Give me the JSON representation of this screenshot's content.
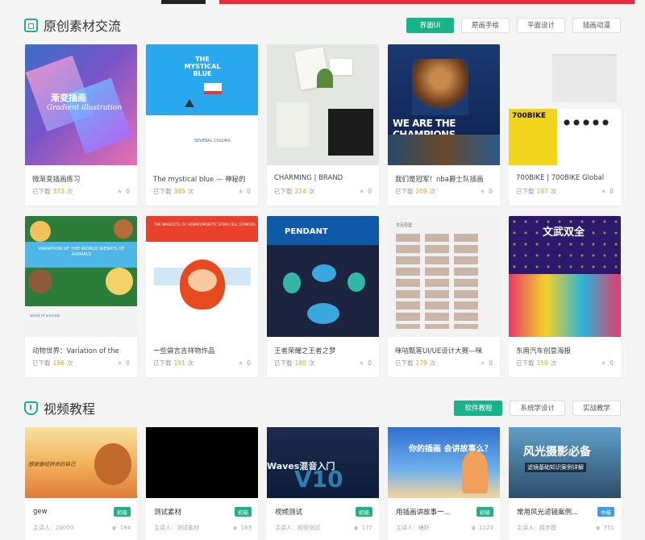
{
  "section1": {
    "title": "原创素材交流",
    "tabs": [
      "界面UI",
      "原画手绘",
      "平面设计",
      "插画动漫"
    ]
  },
  "cards": [
    {
      "title": "微渐变插画练习",
      "downloaded": "已下载",
      "count": "373",
      "unit": "次",
      "likes": "0",
      "thumb_text1": "渐变插画",
      "thumb_text2": "Gradient illustration"
    },
    {
      "title": "The mystical blue — 神秘的",
      "downloaded": "已下载",
      "count": "345",
      "unit": "次",
      "likes": "0",
      "thumb_text1": "THE MYSTICAL BLUE",
      "thumb_text2": "SEVERAL COLORS"
    },
    {
      "title": "CHARMING | BRAND",
      "downloaded": "已下载",
      "count": "224",
      "unit": "次",
      "likes": "0"
    },
    {
      "title": "我们是冠军！nba爵士队插画",
      "downloaded": "已下载",
      "count": "209",
      "unit": "次",
      "likes": "0",
      "thumb_text1": "WE ARE THE CHAMPIONS"
    },
    {
      "title": "700BIKE | 700BIKE Global",
      "downloaded": "已下载",
      "count": "197",
      "unit": "次",
      "likes": "0",
      "thumb_text1": "700BIKE"
    },
    {
      "title": "动物世界：Variation of the",
      "downloaded": "已下载",
      "count": "196",
      "unit": "次",
      "likes": "0",
      "thumb_text1": "VARIATION OF THE WORLD WEIRDS OF ANIMALS",
      "thumb_text2": "world of animals"
    },
    {
      "title": "一些袋言吉祥物作品",
      "downloaded": "已下载",
      "count": "191",
      "unit": "次",
      "likes": "0",
      "thumb_text1": "THE MASCOTS OF HEMATOPOIETIC STEM CELL DONORS"
    },
    {
      "title": "王者荣耀之王者之梦",
      "downloaded": "已下载",
      "count": "180",
      "unit": "次",
      "likes": "0",
      "thumb_text1": "PENDANT"
    },
    {
      "title": "咪咕甄客UI/UE设计大赛—咪",
      "downloaded": "已下载",
      "count": "179",
      "unit": "次",
      "likes": "0",
      "thumb_text1": "交互原型"
    },
    {
      "title": "东南汽车创意海报",
      "downloaded": "已下载",
      "count": "150",
      "unit": "次",
      "likes": "0",
      "thumb_text1": "文武双全"
    }
  ],
  "section2": {
    "title": "视频教程",
    "tabs": [
      "软件教程",
      "系统学设计",
      "实战教学"
    ]
  },
  "videos": [
    {
      "title": "gew",
      "level": "初级",
      "lecturer": "主讲人：20000",
      "views": "184",
      "thumb_text": "感谢曾经拼命的自己"
    },
    {
      "title": "测试素材",
      "level": "初级",
      "lecturer": "主讲人：测试素材",
      "views": "163"
    },
    {
      "title": "视频测试",
      "level": "初级",
      "lecturer": "主讲人：视频测试",
      "views": "177",
      "thumb_text": "Waves混音入门",
      "thumb_big": "V10"
    },
    {
      "title": "用插画讲故事一...",
      "level": "初级",
      "lecturer": "主讲人：睡籽",
      "views": "1123",
      "thumb_text": "你的插画 会讲故事么？"
    },
    {
      "title": "常用风光滤镜案例...",
      "level": "中级",
      "lecturer": "主讲人：独步摸",
      "views": "751",
      "thumb_text": "风光摄影必备",
      "thumb_text2": "滤镜基础知识案例详解"
    }
  ],
  "colors": {
    "accent": "#19b38a",
    "count": "#f39c12",
    "mid_badge": "#3a9ee8"
  }
}
